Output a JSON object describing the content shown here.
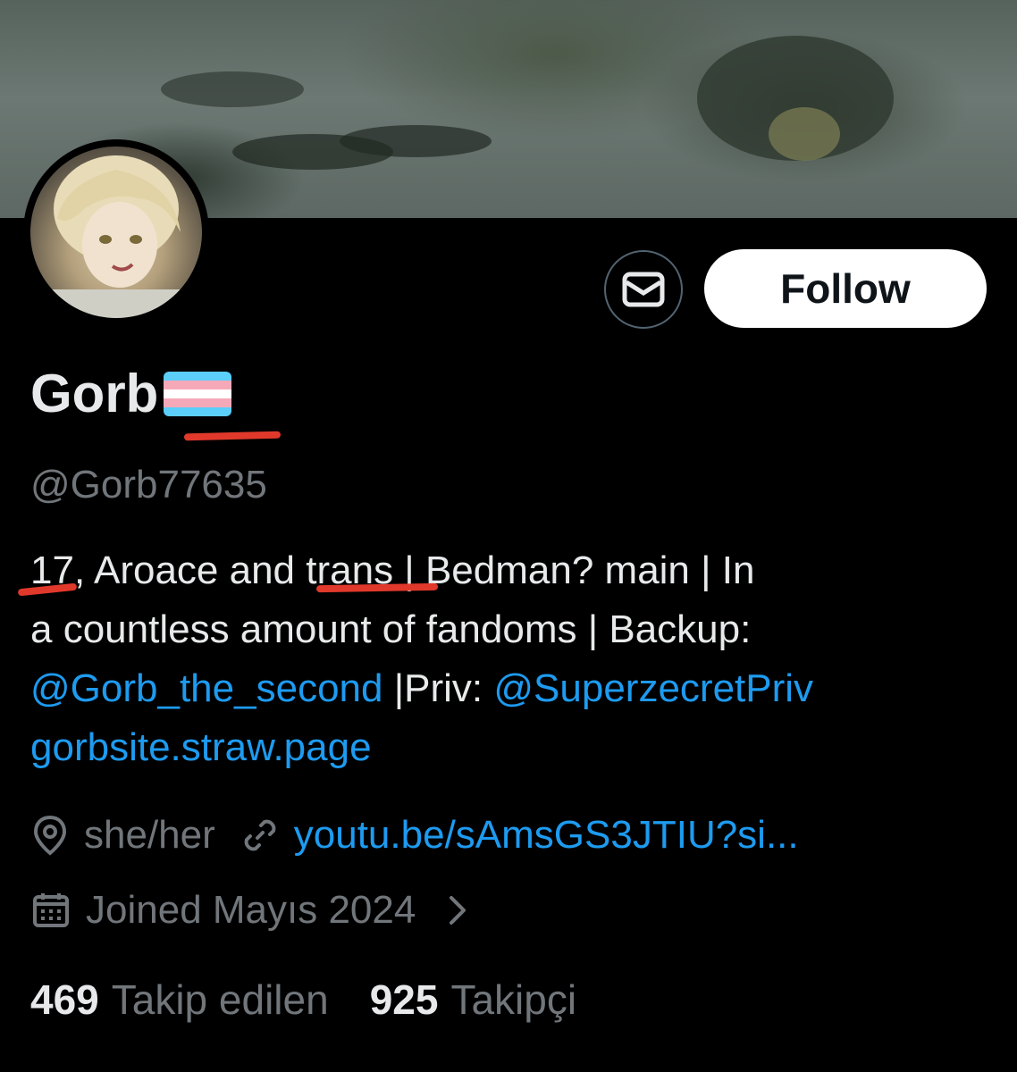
{
  "profile": {
    "display_name": "Gorb",
    "flag_icon": "transgender-flag-icon",
    "handle": "@Gorb77635",
    "bio": {
      "line1": {
        "age": "17",
        "after_age": ", Aroace and ",
        "trans": "trans",
        "rest": " | Bedman? main | In"
      },
      "line2": "a countless amount of fandoms | Backup:",
      "line3": {
        "backup_link": "@Gorb_the_second",
        "priv_text": " |Priv: ",
        "priv_link": "@SuperzecretPriv"
      },
      "line4": "gorbsite.straw.page"
    },
    "location": "she/her",
    "website": "youtu.be/sAmsGS3JTIU?si...",
    "joined": "Joined Mayıs 2024",
    "following_count": "469",
    "following_label": "Takip edilen",
    "followers_count": "925",
    "followers_label": "Takipçi"
  },
  "actions": {
    "message_icon": "envelope-icon",
    "follow_label": "Follow"
  },
  "colors": {
    "background": "#000000",
    "link": "#1d9bf0",
    "muted": "#71767b",
    "annotation_underline": "#e0392b",
    "flag_blue": "#5BCEFA",
    "flag_pink": "#F5A9B8",
    "flag_white": "#FFFFFF"
  }
}
